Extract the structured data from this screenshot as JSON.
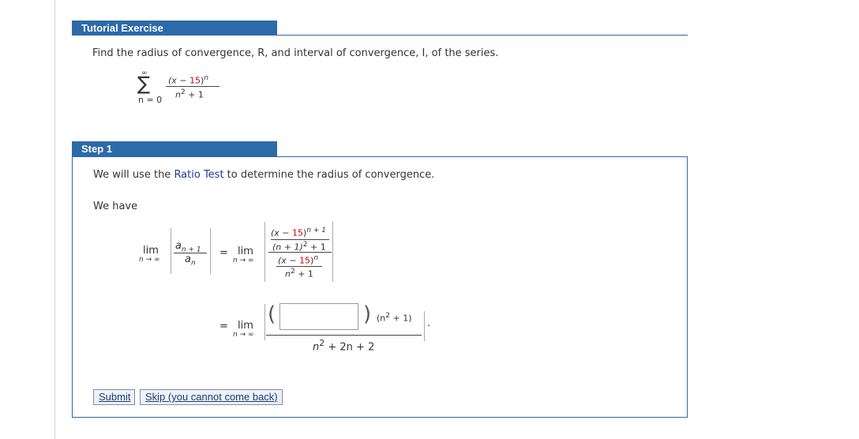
{
  "tutorial": {
    "header": "Tutorial Exercise",
    "prompt": "Find the radius of convergence, R, and interval of convergence, I, of the series."
  },
  "series": {
    "sigma": "∑",
    "upper": "∞",
    "lower": "n = 0",
    "num_open": "(x − ",
    "num_const": "15",
    "num_close": ")",
    "num_exp": "n",
    "den_base": "n",
    "den_exp": "2",
    "den_rest": " + 1"
  },
  "step": {
    "header": "Step 1",
    "intro_before": "We will use the ",
    "intro_link": "Ratio Test",
    "intro_after": " to determine the radius of convergence.",
    "we_have": "We have"
  },
  "math": {
    "lim": "lim",
    "lim_sub": "n → ∞",
    "eq": "=",
    "a_next_base": "a",
    "a_next_sub": "n + 1",
    "a_n_base": "a",
    "a_n_sub": "n",
    "inner_num_open": "(x − ",
    "inner_num_const": "15",
    "inner_num_close": ")",
    "inner_num_exp": "n + 1",
    "inner_den_left": "(n + 1)",
    "inner_den_exp": "2",
    "inner_den_right": " + 1",
    "outer_den_num_open": "(x − ",
    "outer_den_num_const": "15",
    "outer_den_num_close": ")",
    "outer_den_num_exp": "n",
    "outer_den_den_base": "n",
    "outer_den_den_exp": "2",
    "outer_den_den_rest": " + 1",
    "row2_factor_open": "(n",
    "row2_factor_exp": "2",
    "row2_factor_close": " + 1)",
    "row2_den_a": "n",
    "row2_den_exp": "2",
    "row2_den_b": " + 2n + 2",
    "row2_trailing": "."
  },
  "answer_input": {
    "value": ""
  },
  "buttons": {
    "submit": "Submit",
    "skip": "Skip (you cannot come back)"
  },
  "colors": {
    "accent": "#2c6aa8",
    "highlight": "#cc0000",
    "link": "#1a3d9c"
  }
}
